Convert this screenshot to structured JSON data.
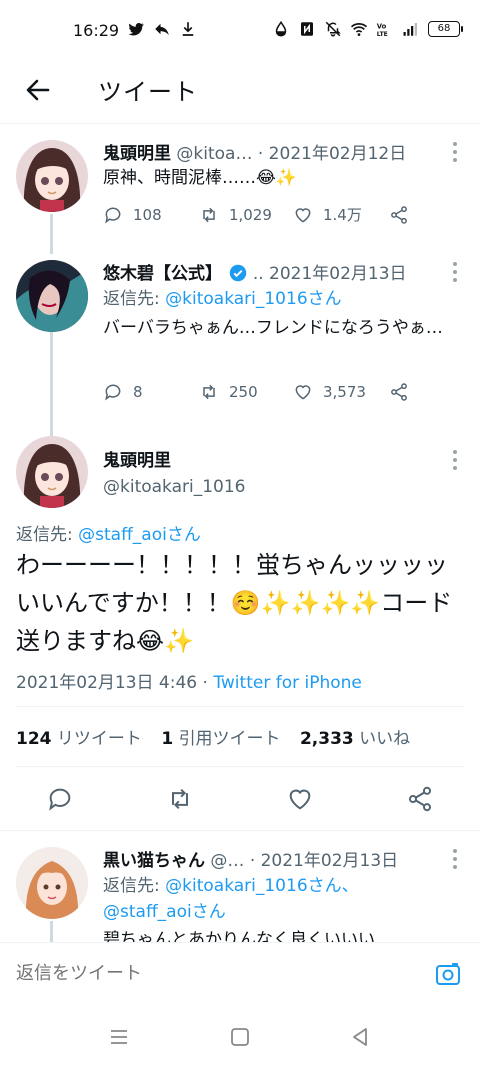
{
  "status_bar": {
    "time": "16:29",
    "left_icons": [
      "twitter-bird-icon",
      "reply-arrow-icon",
      "download-icon"
    ],
    "right_icons": [
      "water-drop-icon",
      "nfc-icon",
      "mute-icon",
      "wifi-icon",
      "volte-icon",
      "signal-icon"
    ],
    "battery": "68"
  },
  "header": {
    "title": "ツイート"
  },
  "tweets": [
    {
      "name": "鬼頭明里",
      "handle": "@kitoa…",
      "date": "· 2021年02月12日",
      "text": "原神、時間泥棒……😂✨",
      "replies": "108",
      "retweets": "1,029",
      "likes": "1.4万"
    },
    {
      "name": "悠木碧【公式】",
      "handle": "..",
      "date": "2021年02月13日",
      "reply_prefix": "返信先: ",
      "reply_to": "@kitoakari_1016さん",
      "text": "バーバラちゃぁん…フレンドになろうやぁ…",
      "replies": "8",
      "retweets": "250",
      "likes": "3,573"
    }
  ],
  "focused": {
    "name": "鬼頭明里",
    "handle": "@kitoakari_1016",
    "reply_prefix": "返信先: ",
    "reply_to": "@staff_aoiさん",
    "text": "わーーーー！！！！！蛍ちゃんッッッッいいんですか！！！☺️✨✨✨✨コード送りますね😂✨",
    "datetime": "2021年02月13日 4:46 · ",
    "source": "Twitter for iPhone",
    "retweet_count": "124",
    "retweet_label": " リツイート",
    "quote_count": "1",
    "quote_label": "引用ツイート",
    "like_count": "2,333",
    "like_label": " いいね"
  },
  "reply_tweet": {
    "name": "黒い猫ちゃん",
    "handle": "@…",
    "date": "· 2021年02月13日",
    "reply_prefix": "返信先: ",
    "reply_to_1": "@kitoakari_1016さん、",
    "reply_to_2": "@staff_aoiさん",
    "text_partial": "碧ちゃんとあかりんなく良くいいい…"
  },
  "composer": {
    "placeholder": "返信をツイート"
  },
  "colors": {
    "accent": "#1d9bf0",
    "text": "#0f1419",
    "secondary": "#536471"
  }
}
